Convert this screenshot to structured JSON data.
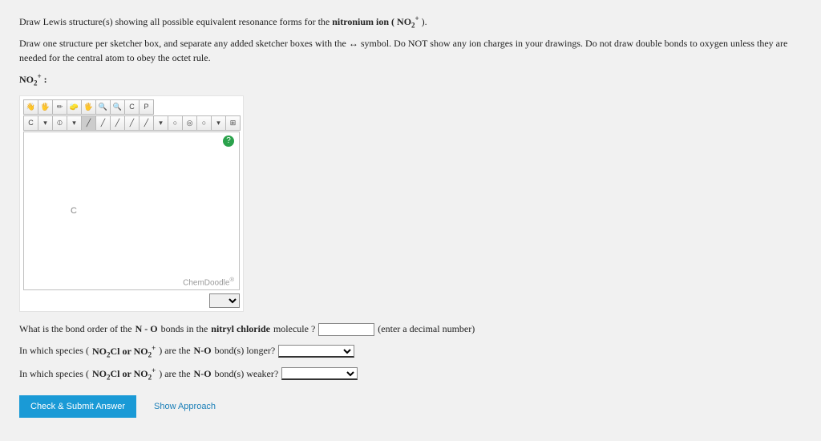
{
  "instructions": {
    "line1_a": "Draw Lewis structure(s) showing all possible equivalent resonance forms for the ",
    "line1_b": "nitronium ion ( NO",
    "line1_c": " ).",
    "line2": "Draw one structure per sketcher box, and separate any added sketcher boxes with the ↔ symbol. Do NOT show any ion charges in your drawings. Do not draw double bonds to oxygen unless they are needed for the central atom to obey the octet rule.",
    "species_label": "NO",
    "species_suffix": " :"
  },
  "toolbar": {
    "row1": [
      "👋",
      "🖐",
      "✏",
      "🧽",
      "🖐",
      "🔍",
      "🔍",
      "C",
      "P"
    ],
    "row2": [
      "C",
      "▾",
      "⦶",
      "▾",
      "╱",
      "╱",
      "╱",
      "╱",
      "╱",
      "▾",
      "○",
      "◎",
      "○",
      "▾",
      "⊞"
    ]
  },
  "canvas": {
    "atom": "C",
    "brand": "ChemDoodle",
    "help": "?"
  },
  "questions": {
    "q1_a": "What is the bond order of the ",
    "q1_b": "N - O",
    "q1_c": " bonds in the ",
    "q1_d": "nitryl chloride",
    "q1_e": " molecule ?",
    "q1_hint": "(enter a decimal number)",
    "q2_a": "In which species (",
    "q2_b": "NO",
    "q2_c": "Cl or NO",
    "q2_d": ") are the ",
    "q2_e": "N-O",
    "q2_f": " bond(s) longer?",
    "q3_a": "In which species (",
    "q3_b": "NO",
    "q3_c": "Cl or NO",
    "q3_d": ") are the ",
    "q3_e": "N-O",
    "q3_f": " bond(s) weaker?"
  },
  "buttons": {
    "check": "Check & Submit Answer",
    "approach": "Show Approach"
  }
}
